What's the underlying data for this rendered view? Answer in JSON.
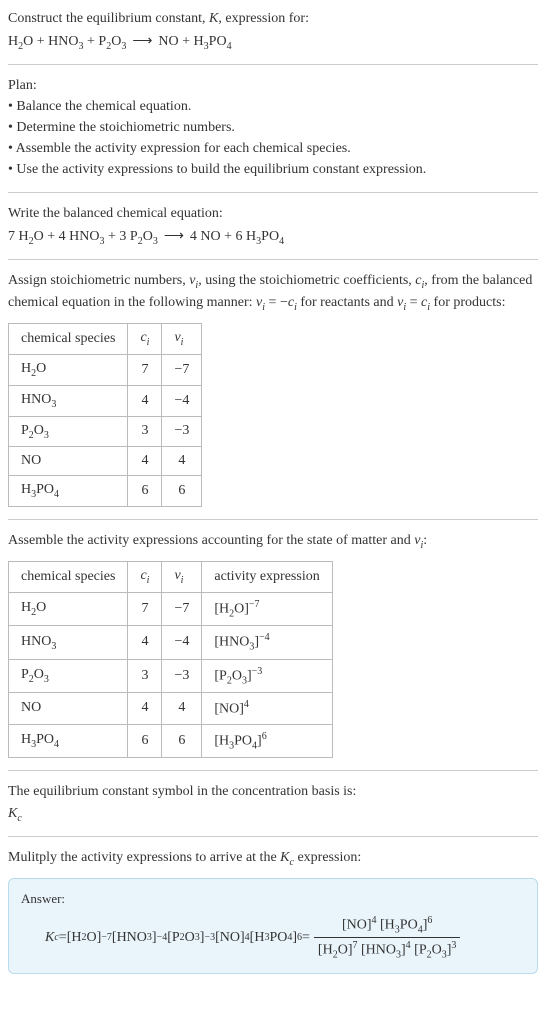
{
  "title_line1": "Construct the equilibrium constant, ",
  "title_K": "K",
  "title_line1b": ", expression for:",
  "unbalanced_eq": {
    "h2o": "H",
    "h2o_2": "2",
    "h2o_O": "O",
    "plus1": " + ",
    "hno3": "HNO",
    "hno3_3": "3",
    "plus2": " + ",
    "p2o3": "P",
    "p2o3_2": "2",
    "p2o3_O": "O",
    "p2o3_3": "3",
    "arrow": "⟶",
    "no": "NO",
    "plus3": " + ",
    "h3po4": "H",
    "h3po4_3": "3",
    "h3po4_PO": "PO",
    "h3po4_4": "4"
  },
  "plan_label": "Plan:",
  "plan_items": [
    "• Balance the chemical equation.",
    "• Determine the stoichiometric numbers.",
    "• Assemble the activity expression for each chemical species.",
    "• Use the activity expressions to build the equilibrium constant expression."
  ],
  "balanced_label": "Write the balanced chemical equation:",
  "balanced_eq": {
    "c1": "7 ",
    "h2o": "H",
    "h2o_2": "2",
    "h2o_O": "O",
    "plus1": " + ",
    "c2": "4 ",
    "hno3": "HNO",
    "hno3_3": "3",
    "plus2": " + ",
    "c3": "3 ",
    "p2o3": "P",
    "p2o3_2": "2",
    "p2o3_O": "O",
    "p2o3_3": "3",
    "arrow": "⟶",
    "c4": "4 ",
    "no": "NO",
    "plus3": " + ",
    "c5": "6 ",
    "h3po4": "H",
    "h3po4_3": "3",
    "h3po4_PO": "PO",
    "h3po4_4": "4"
  },
  "stoich_text1": "Assign stoichiometric numbers, ",
  "nu_i": "ν",
  "sub_i": "i",
  "stoich_text2": ", using the stoichiometric coefficients, ",
  "c_i": "c",
  "stoich_text3": ", from the balanced chemical equation in the following manner: ",
  "eq_neg": " = −",
  "stoich_text4": " for reactants and ",
  "eq_pos": " = ",
  "stoich_text5": " for products:",
  "table1": {
    "headers": {
      "species": "chemical species",
      "ci": "c",
      "ci_sub": "i",
      "nui": "ν",
      "nui_sub": "i"
    },
    "rows": [
      {
        "species_pre": "H",
        "species_sub1": "2",
        "species_mid": "O",
        "species_sub2": "",
        "ci": "7",
        "nui": "−7"
      },
      {
        "species_pre": "HNO",
        "species_sub1": "3",
        "species_mid": "",
        "species_sub2": "",
        "ci": "4",
        "nui": "−4"
      },
      {
        "species_pre": "P",
        "species_sub1": "2",
        "species_mid": "O",
        "species_sub2": "3",
        "ci": "3",
        "nui": "−3"
      },
      {
        "species_pre": "NO",
        "species_sub1": "",
        "species_mid": "",
        "species_sub2": "",
        "ci": "4",
        "nui": "4"
      },
      {
        "species_pre": "H",
        "species_sub1": "3",
        "species_mid": "PO",
        "species_sub2": "4",
        "ci": "6",
        "nui": "6"
      }
    ]
  },
  "assemble_text1": "Assemble the activity expressions accounting for the state of matter and ",
  "assemble_text2": ":",
  "table2": {
    "headers": {
      "species": "chemical species",
      "ci": "c",
      "ci_sub": "i",
      "nui": "ν",
      "nui_sub": "i",
      "activity": "activity expression"
    },
    "rows": [
      {
        "species_pre": "H",
        "species_sub1": "2",
        "species_mid": "O",
        "species_sub2": "",
        "ci": "7",
        "nui": "−7",
        "act_pre": "[H",
        "act_sub1": "2",
        "act_mid": "O]",
        "act_sub2": "",
        "act_sup": "−7"
      },
      {
        "species_pre": "HNO",
        "species_sub1": "3",
        "species_mid": "",
        "species_sub2": "",
        "ci": "4",
        "nui": "−4",
        "act_pre": "[HNO",
        "act_sub1": "3",
        "act_mid": "]",
        "act_sub2": "",
        "act_sup": "−4"
      },
      {
        "species_pre": "P",
        "species_sub1": "2",
        "species_mid": "O",
        "species_sub2": "3",
        "ci": "3",
        "nui": "−3",
        "act_pre": "[P",
        "act_sub1": "2",
        "act_mid": "O",
        "act_sub2": "3",
        "act_mid2": "]",
        "act_sup": "−3"
      },
      {
        "species_pre": "NO",
        "species_sub1": "",
        "species_mid": "",
        "species_sub2": "",
        "ci": "4",
        "nui": "4",
        "act_pre": "[NO]",
        "act_sub1": "",
        "act_mid": "",
        "act_sub2": "",
        "act_sup": "4"
      },
      {
        "species_pre": "H",
        "species_sub1": "3",
        "species_mid": "PO",
        "species_sub2": "4",
        "ci": "6",
        "nui": "6",
        "act_pre": "[H",
        "act_sub1": "3",
        "act_mid": "PO",
        "act_sub2": "4",
        "act_mid2": "]",
        "act_sup": "6"
      }
    ]
  },
  "symbol_text": "The equilibrium constant symbol in the concentration basis is:",
  "kc_symbol": "K",
  "kc_sub": "c",
  "multiply_text": "Mulitply the activity expressions to arrive at the ",
  "multiply_text2": " expression:",
  "answer_label": "Answer:",
  "final": {
    "kc": "K",
    "kc_c": "c",
    "eq": " = ",
    "t1_pre": "[H",
    "t1_s1": "2",
    "t1_mid": "O]",
    "t1_sup": "−7",
    "sp": " ",
    "t2_pre": "[HNO",
    "t2_s1": "3",
    "t2_mid": "]",
    "t2_sup": "−4",
    "t3_pre": "[P",
    "t3_s1": "2",
    "t3_mid": "O",
    "t3_s2": "3",
    "t3_mid2": "]",
    "t3_sup": "−3",
    "t4_pre": "[NO]",
    "t4_sup": "4",
    "t5_pre": "[H",
    "t5_s1": "3",
    "t5_mid": "PO",
    "t5_s2": "4",
    "t5_mid2": "]",
    "t5_sup": "6",
    "eq2": " = ",
    "num_t4_pre": "[NO]",
    "num_t4_sup": "4",
    "num_t5_pre": "[H",
    "num_t5_s1": "3",
    "num_t5_mid": "PO",
    "num_t5_s2": "4",
    "num_t5_mid2": "]",
    "num_t5_sup": "6",
    "den_t1_pre": "[H",
    "den_t1_s1": "2",
    "den_t1_mid": "O]",
    "den_t1_sup": "7",
    "den_t2_pre": "[HNO",
    "den_t2_s1": "3",
    "den_t2_mid": "]",
    "den_t2_sup": "4",
    "den_t3_pre": "[P",
    "den_t3_s1": "2",
    "den_t3_mid": "O",
    "den_t3_s2": "3",
    "den_t3_mid2": "]",
    "den_t3_sup": "3"
  }
}
